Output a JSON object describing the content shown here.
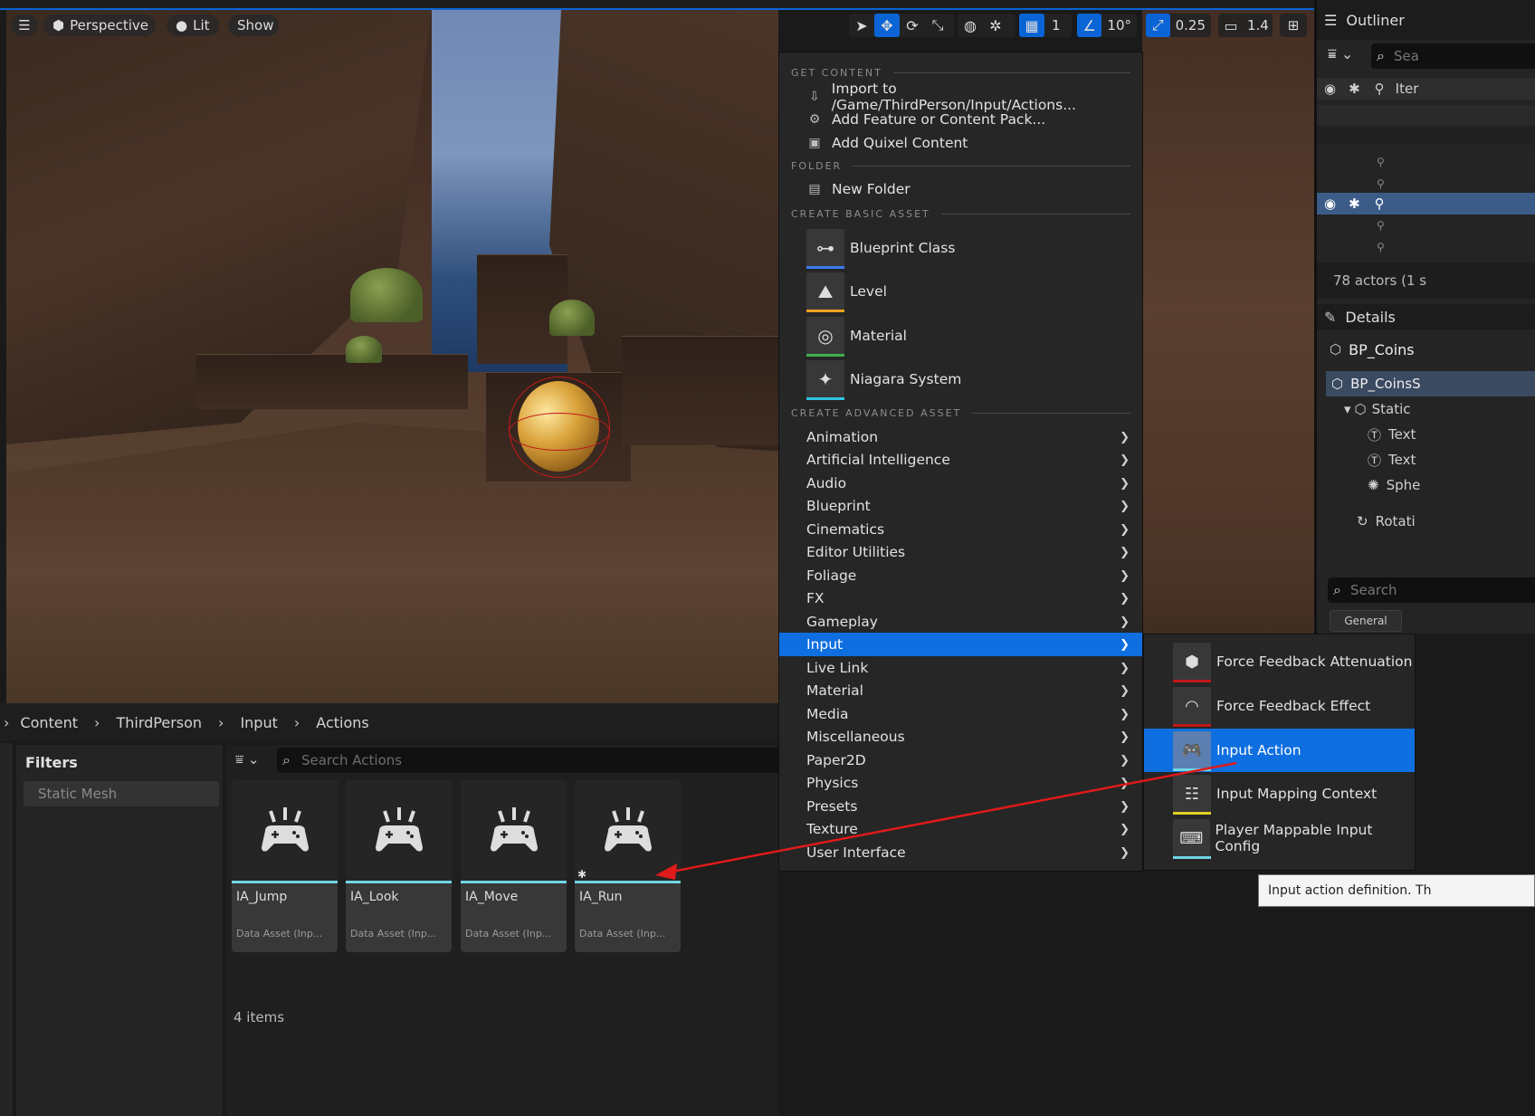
{
  "viewport": {
    "menu_icon": "hamburger-icon",
    "perspective_label": "Perspective",
    "lit_label": "Lit",
    "show_label": "Show",
    "grid_snap_value": "1",
    "rotation_snap_value": "10°",
    "scale_snap_value": "0.25",
    "camera_speed_value": "1.4"
  },
  "outliner": {
    "title": "Outliner",
    "search_placeholder": "Sea",
    "col_item_label": "Iter",
    "actor_count": "78 actors (1 s"
  },
  "details": {
    "title": "Details",
    "object_name": "BP_Coins",
    "component_root": "BP_CoinsS",
    "component_static": "Static",
    "component_text1": "Text",
    "component_text2": "Text",
    "component_sphere": "Sphe",
    "component_rotating": "Rotati",
    "search_placeholder": "Search",
    "tab_general": "General"
  },
  "content_browser": {
    "breadcrumb": [
      "Content",
      "ThirdPerson",
      "Input",
      "Actions"
    ],
    "filters_label": "Filters",
    "filter_static_mesh": "Static Mesh",
    "search_placeholder": "Search Actions",
    "item_count": "4 items",
    "assets": [
      {
        "name": "IA_Jump",
        "type": "Data Asset (Inp..."
      },
      {
        "name": "IA_Look",
        "type": "Data Asset (Inp..."
      },
      {
        "name": "IA_Move",
        "type": "Data Asset (Inp..."
      },
      {
        "name": "IA_Run",
        "type": "Data Asset (Inp..."
      }
    ]
  },
  "context_menu": {
    "sections": {
      "get_content": "GET CONTENT",
      "folder": "FOLDER",
      "create_basic": "CREATE BASIC ASSET",
      "create_advanced": "CREATE ADVANCED ASSET"
    },
    "get_content_items": [
      "Import to /Game/ThirdPerson/Input/Actions...",
      "Add Feature or Content Pack...",
      "Add Quixel Content"
    ],
    "new_folder": "New Folder",
    "basic_assets": [
      "Blueprint Class",
      "Level",
      "Material",
      "Niagara System"
    ],
    "advanced_items": [
      "Animation",
      "Artificial Intelligence",
      "Audio",
      "Blueprint",
      "Cinematics",
      "Editor Utilities",
      "Foliage",
      "FX",
      "Gameplay",
      "Input",
      "Live Link",
      "Material",
      "Media",
      "Miscellaneous",
      "Paper2D",
      "Physics",
      "Presets",
      "Texture",
      "User Interface"
    ],
    "highlighted": "Input"
  },
  "input_submenu": {
    "items": [
      "Force Feedback Attenuation",
      "Force Feedback Effect",
      "Input Action",
      "Input Mapping Context",
      "Player Mappable Input Config"
    ],
    "highlighted": "Input Action"
  },
  "tooltip": {
    "text": "Input action definition. Th"
  },
  "colors": {
    "highlight": "#0f6fe0",
    "annotation_arrow": "#e01a1a",
    "asset_underline": "#6fd6e6"
  }
}
